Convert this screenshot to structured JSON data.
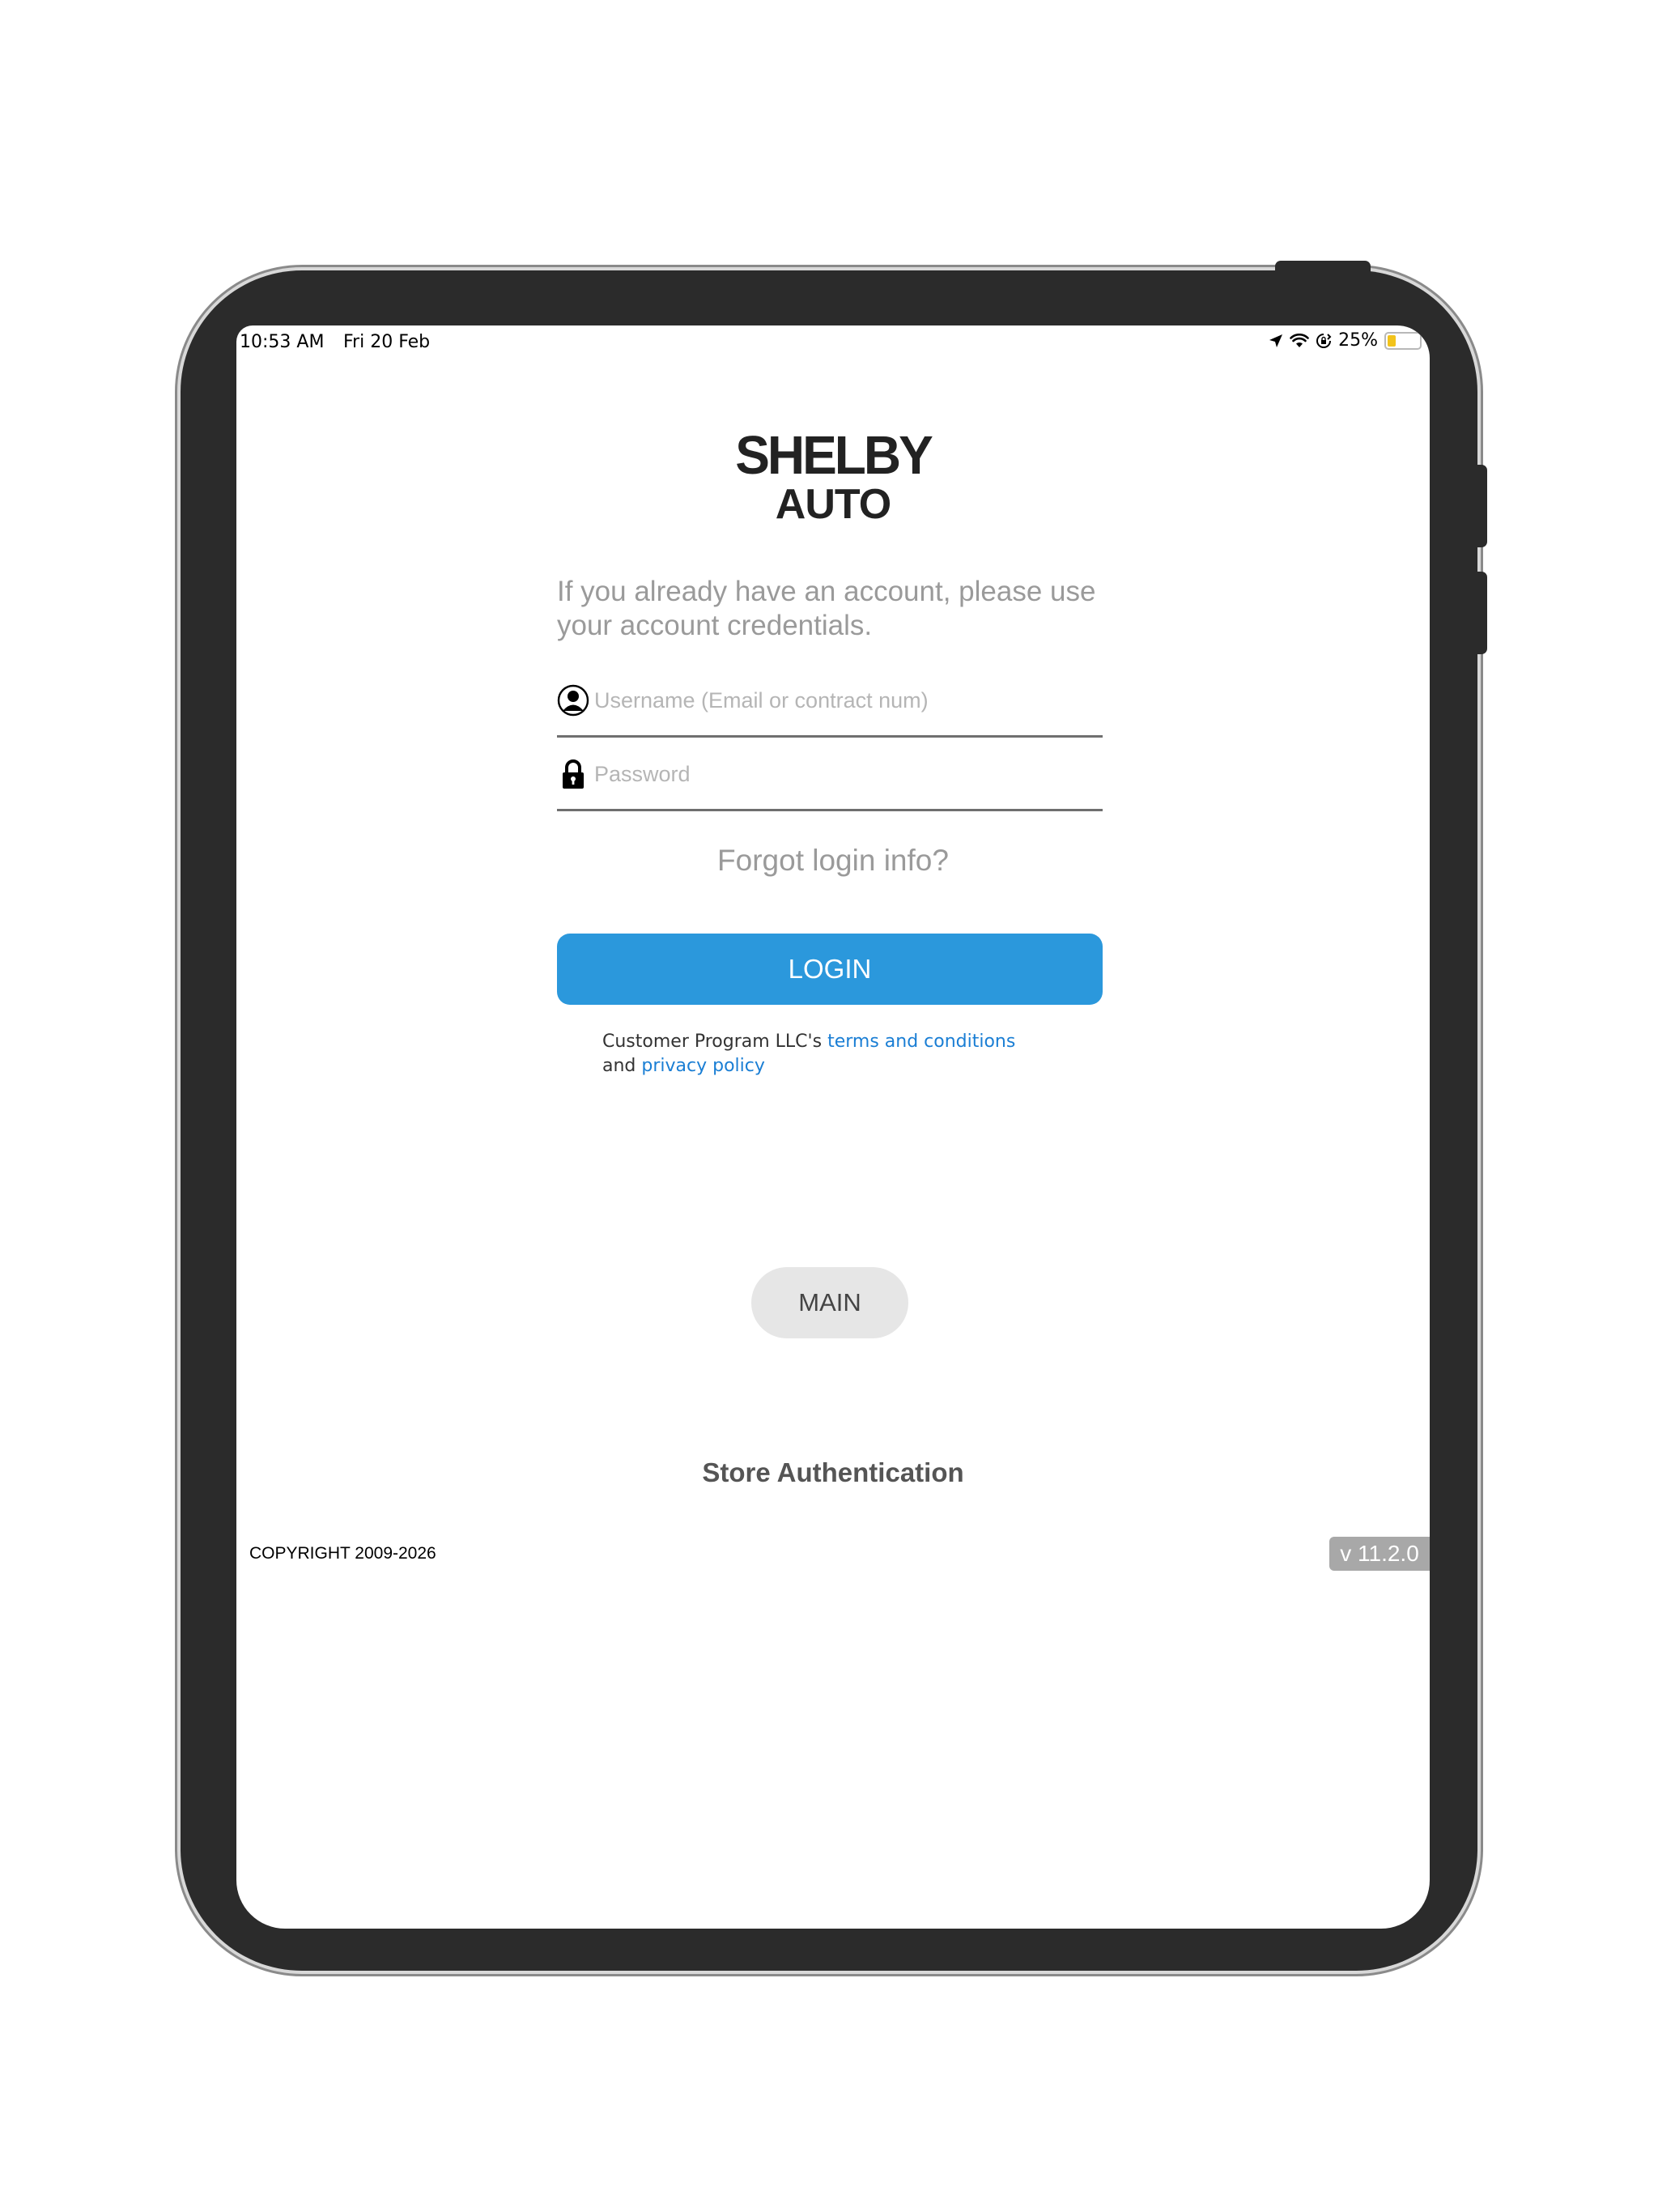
{
  "status_bar": {
    "time": "10:53 AM",
    "date": "Fri 20 Feb",
    "battery_percent": "25%",
    "battery_level": 0.25,
    "icons": [
      "location-arrow-icon",
      "wifi-icon",
      "orientation-lock-icon",
      "battery-icon"
    ]
  },
  "logo": {
    "line1": "SHELBY",
    "line2": "AUTO"
  },
  "login": {
    "intro": "If you already have an account, please use your account credentials.",
    "username_placeholder": "Username (Email or contract num)",
    "password_placeholder": "Password",
    "forgot_label": "Forgot login info?",
    "login_label": "LOGIN"
  },
  "terms": {
    "prefix": "Customer Program LLC's ",
    "terms_link": "terms and conditions",
    "and": "and ",
    "privacy_link": "privacy policy"
  },
  "main_button": "MAIN",
  "store_auth": "Store Authentication",
  "footer": {
    "copyright": "COPYRIGHT 2009-2026",
    "version": "v 11.2.0"
  },
  "colors": {
    "accent": "#2b98dc",
    "link": "#1a7ed4",
    "device_frame": "#2b2b2b",
    "battery": "#f2c31b"
  }
}
